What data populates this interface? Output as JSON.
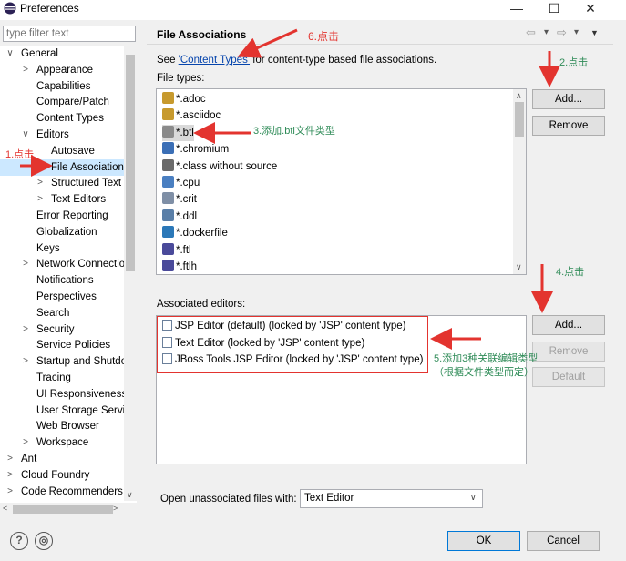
{
  "window": {
    "title": "Preferences",
    "minimize": "—",
    "maximize": "☐",
    "close": "✕"
  },
  "filter": {
    "placeholder": "type filter text"
  },
  "tree": [
    {
      "label": "General",
      "tw": "∨",
      "level": 0
    },
    {
      "label": "Appearance",
      "tw": ">",
      "level": 1
    },
    {
      "label": "Capabilities",
      "tw": "",
      "level": 1
    },
    {
      "label": "Compare/Patch",
      "tw": "",
      "level": 1
    },
    {
      "label": "Content Types",
      "tw": "",
      "level": 1
    },
    {
      "label": "Editors",
      "tw": "∨",
      "level": 1
    },
    {
      "label": "Autosave",
      "tw": "",
      "level": 2
    },
    {
      "label": "File Associations",
      "tw": "",
      "level": 2,
      "selected": true
    },
    {
      "label": "Structured Text Editors",
      "tw": ">",
      "level": 2
    },
    {
      "label": "Text Editors",
      "tw": ">",
      "level": 2
    },
    {
      "label": "Error Reporting",
      "tw": "",
      "level": 1
    },
    {
      "label": "Globalization",
      "tw": "",
      "level": 1
    },
    {
      "label": "Keys",
      "tw": "",
      "level": 1
    },
    {
      "label": "Network Connections",
      "tw": ">",
      "level": 1
    },
    {
      "label": "Notifications",
      "tw": "",
      "level": 1
    },
    {
      "label": "Perspectives",
      "tw": "",
      "level": 1
    },
    {
      "label": "Search",
      "tw": "",
      "level": 1
    },
    {
      "label": "Security",
      "tw": ">",
      "level": 1
    },
    {
      "label": "Service Policies",
      "tw": "",
      "level": 1
    },
    {
      "label": "Startup and Shutdown",
      "tw": ">",
      "level": 1
    },
    {
      "label": "Tracing",
      "tw": "",
      "level": 1
    },
    {
      "label": "UI Responsiveness",
      "tw": "",
      "level": 1
    },
    {
      "label": "User Storage Service",
      "tw": "",
      "level": 1
    },
    {
      "label": "Web Browser",
      "tw": "",
      "level": 1
    },
    {
      "label": "Workspace",
      "tw": ">",
      "level": 1
    },
    {
      "label": "Ant",
      "tw": ">",
      "level": 0
    },
    {
      "label": "Cloud Foundry",
      "tw": ">",
      "level": 0
    },
    {
      "label": "Code Recommenders",
      "tw": ">",
      "level": 0
    }
  ],
  "page": {
    "title": "File Associations",
    "see_prefix": "See ",
    "content_types_link": "'Content Types'",
    "see_suffix": " for content-type based file associations.",
    "file_types_label": "File types:",
    "associated_editors_label": "Associated editors:",
    "open_unassociated_label": "Open unassociated files with:",
    "open_unassociated_value": "Text Editor"
  },
  "nav": {
    "back": "⇦",
    "forward": "⇨",
    "dropdown": "▾",
    "menu": "▼"
  },
  "file_types": [
    {
      "label": "*.adoc",
      "color": "#c79a2e"
    },
    {
      "label": "*.asciidoc",
      "color": "#c79a2e"
    },
    {
      "label": "*.btl",
      "color": "#8a8a8a",
      "selected": true
    },
    {
      "label": "*.chromium",
      "color": "#3b6fb6"
    },
    {
      "label": "*.class without source",
      "color": "#6a6a6a"
    },
    {
      "label": "*.cpu",
      "color": "#4a7fc1"
    },
    {
      "label": "*.crit",
      "color": "#7f8fa6"
    },
    {
      "label": "*.ddl",
      "color": "#5a7fa8"
    },
    {
      "label": "*.dockerfile",
      "color": "#2b78b8"
    },
    {
      "label": "*.ftl",
      "color": "#4a4a9a"
    },
    {
      "label": "*.ftlh",
      "color": "#4a4a9a"
    }
  ],
  "file_type_buttons": {
    "add": "Add...",
    "remove": "Remove"
  },
  "associated_editors": [
    "JSP Editor (default) (locked by 'JSP' content type)",
    "Text Editor (locked by 'JSP' content type)",
    "JBoss Tools JSP Editor (locked by 'JSP' content type)"
  ],
  "editor_buttons": {
    "add": "Add...",
    "remove": "Remove",
    "default": "Default"
  },
  "footer": {
    "help_icon": "?",
    "prefs_icon": "◎",
    "ok": "OK",
    "cancel": "Cancel"
  },
  "annotations": {
    "a1": "1.点击",
    "a2": "2.点击",
    "a3": "3.添加.btl文件类型",
    "a4": "4.点击",
    "a5_line1": "5.添加3种关联编辑类型",
    "a5_line2": "（根据文件类型而定）",
    "a6": "6.点击"
  },
  "colors": {
    "annotation_red": "#e3342f",
    "annotation_green": "#2e8b57",
    "link": "#0645ad",
    "selection": "#cce8ff"
  }
}
